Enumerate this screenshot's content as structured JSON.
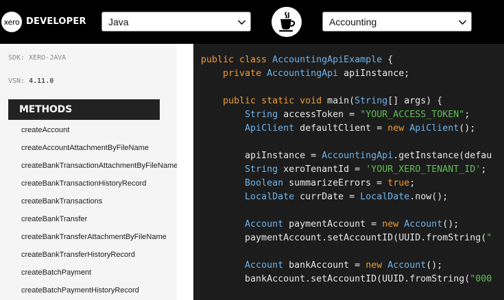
{
  "header": {
    "logo_text": "xero",
    "title": "DEVELOPER",
    "language_select": {
      "value": "Java",
      "options": [
        "Java"
      ]
    },
    "api_select": {
      "value": "Accounting",
      "options": [
        "Accounting"
      ]
    },
    "language_icon": "java-coffee-cup-icon"
  },
  "sidebar": {
    "sdk_label": "SDK: XERO-JAVA",
    "vsn_label": "VSN:",
    "vsn_value": "4.11.0",
    "methods_title": "METHODS",
    "methods": [
      "createAccount",
      "createAccountAttachmentByFileName",
      "createBankTransactionAttachmentByFileName",
      "createBankTransactionHistoryRecord",
      "createBankTransactions",
      "createBankTransfer",
      "createBankTransferAttachmentByFileName",
      "createBankTransferHistoryRecord",
      "createBatchPayment",
      "createBatchPaymentHistoryRecord"
    ]
  },
  "code": {
    "lines": [
      [
        [
          "k",
          "public class "
        ],
        [
          "t",
          "AccountingApiExample"
        ],
        [
          "p",
          " {"
        ]
      ],
      [
        [
          "p",
          "    "
        ],
        [
          "k",
          "private "
        ],
        [
          "t",
          "AccountingApi"
        ],
        [
          "p",
          " apiInstance;"
        ]
      ],
      [],
      [
        [
          "p",
          "    "
        ],
        [
          "k",
          "public static void "
        ],
        [
          "p",
          "main("
        ],
        [
          "t",
          "String"
        ],
        [
          "p",
          "[] args) {"
        ]
      ],
      [
        [
          "p",
          "        "
        ],
        [
          "t",
          "String"
        ],
        [
          "p",
          " accessToken = "
        ],
        [
          "s",
          "\"YOUR_ACCESS_TOKEN\""
        ],
        [
          "p",
          ";"
        ]
      ],
      [
        [
          "p",
          "        "
        ],
        [
          "t",
          "ApiClient"
        ],
        [
          "p",
          " defaultClient = "
        ],
        [
          "k",
          "new "
        ],
        [
          "t",
          "ApiClient"
        ],
        [
          "p",
          "();"
        ]
      ],
      [],
      [
        [
          "p",
          "        apiInstance = "
        ],
        [
          "t",
          "AccountingApi"
        ],
        [
          "p",
          ".getInstance(defau"
        ]
      ],
      [
        [
          "p",
          "        "
        ],
        [
          "t",
          "String"
        ],
        [
          "p",
          " xeroTenantId = "
        ],
        [
          "s",
          "'YOUR_XERO_TENANT_ID'"
        ],
        [
          "p",
          ";"
        ]
      ],
      [
        [
          "p",
          "        "
        ],
        [
          "t",
          "Boolean"
        ],
        [
          "p",
          " summarizeErrors = "
        ],
        [
          "k",
          "true"
        ],
        [
          "p",
          ";"
        ]
      ],
      [
        [
          "p",
          "        "
        ],
        [
          "t",
          "LocalDate"
        ],
        [
          "p",
          " currDate = "
        ],
        [
          "t",
          "LocalDate"
        ],
        [
          "p",
          ".now();"
        ]
      ],
      [],
      [
        [
          "p",
          "        "
        ],
        [
          "t",
          "Account"
        ],
        [
          "p",
          " paymentAccount = "
        ],
        [
          "k",
          "new "
        ],
        [
          "t",
          "Account"
        ],
        [
          "p",
          "();"
        ]
      ],
      [
        [
          "p",
          "        paymentAccount.setAccountID(UUID.fromString("
        ],
        [
          "s",
          "\""
        ]
      ],
      [],
      [
        [
          "p",
          "        "
        ],
        [
          "t",
          "Account"
        ],
        [
          "p",
          " bankAccount = "
        ],
        [
          "k",
          "new "
        ],
        [
          "t",
          "Account"
        ],
        [
          "p",
          "();"
        ]
      ],
      [
        [
          "p",
          "        bankAccount.setAccountID(UUID.fromString("
        ],
        [
          "s",
          "\"000"
        ]
      ]
    ]
  },
  "colors": {
    "keyword": "#ee9c39",
    "type": "#6fb3ea",
    "string": "#5fbf55",
    "code_bg": "#1c1c1c",
    "header_bg": "#000000",
    "sidebar_bg": "#f5f5f5"
  }
}
